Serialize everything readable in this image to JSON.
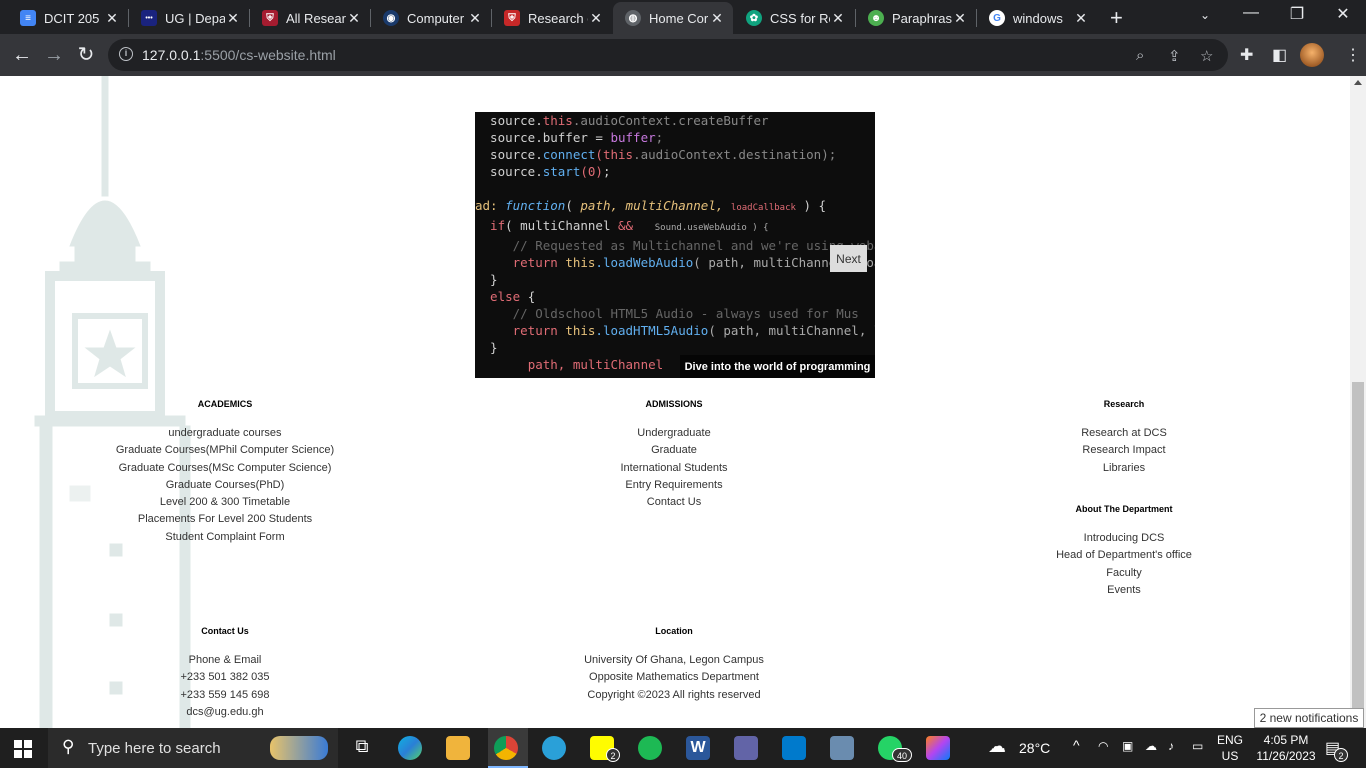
{
  "browser": {
    "tabs": [
      {
        "title": "DCIT 205",
        "icon": "docs-icon",
        "color": "#4285f4"
      },
      {
        "title": "UG | Depa",
        "icon": "ug-icon",
        "color": "#1a237e"
      },
      {
        "title": "All Resear",
        "icon": "crest-icon",
        "color": "#a51c30"
      },
      {
        "title": "Computer",
        "icon": "shield-icon",
        "color": "#1a3a6b"
      },
      {
        "title": "Research c",
        "icon": "crest-icon",
        "color": "#c62828"
      },
      {
        "title": "Home Cor",
        "icon": "globe-icon",
        "color": "#9aa0a6",
        "active": true
      },
      {
        "title": "CSS for Re",
        "icon": "chatgpt-icon",
        "color": "#10a37f"
      },
      {
        "title": "Paraphras",
        "icon": "robot-icon",
        "color": "#4caf50"
      },
      {
        "title": "windows",
        "icon": "google-icon",
        "color": "#ffffff"
      }
    ],
    "url_host": "127.0.0.1",
    "url_rest": ":5500/cs-website.html"
  },
  "slider": {
    "next_label": "Next",
    "caption": "Dive into the world of programming"
  },
  "academics": {
    "heading": "ACADEMICS",
    "links": [
      "undergraduate courses",
      "Graduate Courses(MPhil Computer Science)",
      "Graduate Courses(MSc Computer Science)",
      "Graduate Courses(PhD)",
      "Level 200 & 300 Timetable",
      "Placements For Level 200 Students",
      "Student Complaint Form"
    ]
  },
  "admissions": {
    "heading": "ADMISSIONS",
    "links": [
      "Undergraduate",
      "Graduate",
      "International Students",
      "Entry Requirements",
      "Contact Us"
    ]
  },
  "research": {
    "heading": "Research",
    "links": [
      "Research at DCS",
      "Research Impact",
      "Libraries"
    ]
  },
  "about": {
    "heading": "About The Department",
    "links": [
      "Introducing DCS",
      "Head of Department's office",
      "Faculty",
      "Events"
    ]
  },
  "contact": {
    "heading": "Contact Us",
    "lines": [
      "Phone & Email",
      "+233 501 382 035",
      "+233 559 145 698",
      "dcs@ug.edu.gh"
    ]
  },
  "location": {
    "heading": "Location",
    "lines": [
      "University Of Ghana, Legon Campus",
      "Opposite Mathematics Department",
      "Copyright ©2023 All rights reserved"
    ]
  },
  "taskbar": {
    "search_placeholder": "Type here to search",
    "snapchat_badge": "2",
    "whatsapp_badge": "40",
    "weather": "28°C",
    "lang1": "ENG",
    "lang2": "US",
    "time": "4:05 PM",
    "date": "11/26/2023",
    "notif_count": "2",
    "notif_tip": "2 new notifications"
  }
}
